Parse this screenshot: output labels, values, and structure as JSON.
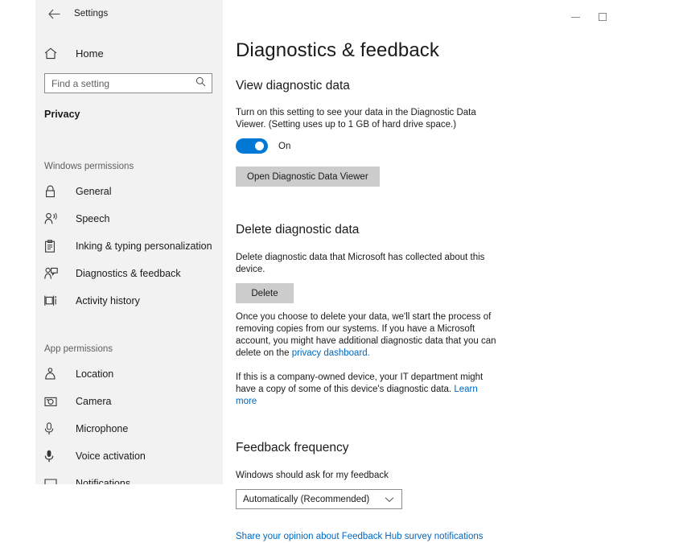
{
  "window": {
    "minimize_label": "Minimize",
    "maximize_label": "Maximize"
  },
  "sidebar": {
    "back_label": "Back",
    "title": "Settings",
    "home_label": "Home",
    "search": {
      "placeholder": "Find a setting",
      "value": ""
    },
    "category": "Privacy",
    "groups": [
      {
        "header": "Windows permissions",
        "items": [
          {
            "label": "General",
            "icon": "lock-icon"
          },
          {
            "label": "Speech",
            "icon": "speech-person-icon"
          },
          {
            "label": "Inking & typing personalization",
            "icon": "clipboard-icon"
          },
          {
            "label": "Diagnostics & feedback",
            "icon": "feedback-person-icon"
          },
          {
            "label": "Activity history",
            "icon": "activity-history-icon"
          }
        ]
      },
      {
        "header": "App permissions",
        "items": [
          {
            "label": "Location",
            "icon": "location-pin-icon"
          },
          {
            "label": "Camera",
            "icon": "camera-icon"
          },
          {
            "label": "Microphone",
            "icon": "microphone-icon"
          },
          {
            "label": "Voice activation",
            "icon": "voice-activation-icon"
          },
          {
            "label": "Notifications",
            "icon": "notification-icon"
          }
        ]
      }
    ]
  },
  "main": {
    "page_title": "Diagnostics & feedback",
    "view_section": {
      "heading": "View diagnostic data",
      "description": "Turn on this setting to see your data in the Diagnostic Data Viewer. (Setting uses up to 1 GB of hard drive space.)",
      "toggle_state": "On",
      "toggle_on": true,
      "button_label": "Open Diagnostic Data Viewer"
    },
    "delete_section": {
      "heading": "Delete diagnostic data",
      "description": "Delete diagnostic data that Microsoft has collected about this device.",
      "button_label": "Delete",
      "note_prefix": "Once you choose to delete your data, we'll start the process of removing copies from our systems. If you have a Microsoft account, you might have additional diagnostic data that you can delete on the ",
      "note_link": "privacy dashboard.",
      "company_prefix": "If this is a company-owned device, your IT department might have a copy of some of this device's diagnostic data. ",
      "company_link": "Learn more"
    },
    "feedback_section": {
      "heading": "Feedback frequency",
      "label": "Windows should ask for my feedback",
      "selected_option": "Automatically (Recommended)",
      "share_link": "Share your opinion about Feedback Hub survey notifications"
    }
  },
  "colors": {
    "accent": "#0078d4",
    "link": "#0067c0",
    "sidebar_bg": "#f2f2f2",
    "button_bg": "#cccccc"
  }
}
